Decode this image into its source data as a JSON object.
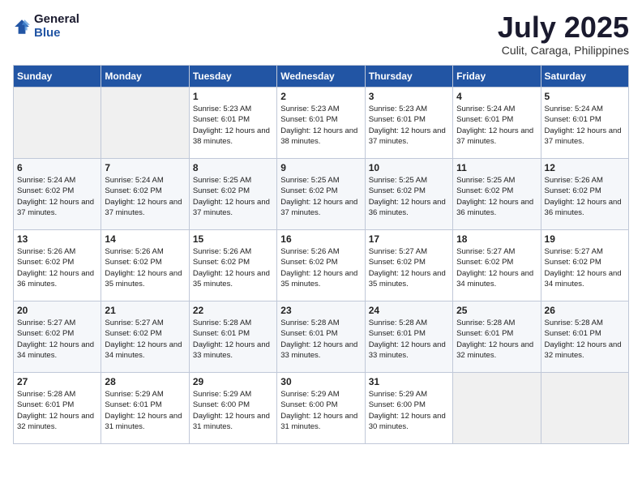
{
  "logo": {
    "general": "General",
    "blue": "Blue"
  },
  "title": "July 2025",
  "location": "Culit, Caraga, Philippines",
  "days_of_week": [
    "Sunday",
    "Monday",
    "Tuesday",
    "Wednesday",
    "Thursday",
    "Friday",
    "Saturday"
  ],
  "weeks": [
    [
      {
        "day": "",
        "sunrise": "",
        "sunset": "",
        "daylight": ""
      },
      {
        "day": "",
        "sunrise": "",
        "sunset": "",
        "daylight": ""
      },
      {
        "day": "1",
        "sunrise": "5:23 AM",
        "sunset": "6:01 PM",
        "daylight": "12 hours and 38 minutes."
      },
      {
        "day": "2",
        "sunrise": "5:23 AM",
        "sunset": "6:01 PM",
        "daylight": "12 hours and 38 minutes."
      },
      {
        "day": "3",
        "sunrise": "5:23 AM",
        "sunset": "6:01 PM",
        "daylight": "12 hours and 37 minutes."
      },
      {
        "day": "4",
        "sunrise": "5:24 AM",
        "sunset": "6:01 PM",
        "daylight": "12 hours and 37 minutes."
      },
      {
        "day": "5",
        "sunrise": "5:24 AM",
        "sunset": "6:01 PM",
        "daylight": "12 hours and 37 minutes."
      }
    ],
    [
      {
        "day": "6",
        "sunrise": "5:24 AM",
        "sunset": "6:02 PM",
        "daylight": "12 hours and 37 minutes."
      },
      {
        "day": "7",
        "sunrise": "5:24 AM",
        "sunset": "6:02 PM",
        "daylight": "12 hours and 37 minutes."
      },
      {
        "day": "8",
        "sunrise": "5:25 AM",
        "sunset": "6:02 PM",
        "daylight": "12 hours and 37 minutes."
      },
      {
        "day": "9",
        "sunrise": "5:25 AM",
        "sunset": "6:02 PM",
        "daylight": "12 hours and 37 minutes."
      },
      {
        "day": "10",
        "sunrise": "5:25 AM",
        "sunset": "6:02 PM",
        "daylight": "12 hours and 36 minutes."
      },
      {
        "day": "11",
        "sunrise": "5:25 AM",
        "sunset": "6:02 PM",
        "daylight": "12 hours and 36 minutes."
      },
      {
        "day": "12",
        "sunrise": "5:26 AM",
        "sunset": "6:02 PM",
        "daylight": "12 hours and 36 minutes."
      }
    ],
    [
      {
        "day": "13",
        "sunrise": "5:26 AM",
        "sunset": "6:02 PM",
        "daylight": "12 hours and 36 minutes."
      },
      {
        "day": "14",
        "sunrise": "5:26 AM",
        "sunset": "6:02 PM",
        "daylight": "12 hours and 35 minutes."
      },
      {
        "day": "15",
        "sunrise": "5:26 AM",
        "sunset": "6:02 PM",
        "daylight": "12 hours and 35 minutes."
      },
      {
        "day": "16",
        "sunrise": "5:26 AM",
        "sunset": "6:02 PM",
        "daylight": "12 hours and 35 minutes."
      },
      {
        "day": "17",
        "sunrise": "5:27 AM",
        "sunset": "6:02 PM",
        "daylight": "12 hours and 35 minutes."
      },
      {
        "day": "18",
        "sunrise": "5:27 AM",
        "sunset": "6:02 PM",
        "daylight": "12 hours and 34 minutes."
      },
      {
        "day": "19",
        "sunrise": "5:27 AM",
        "sunset": "6:02 PM",
        "daylight": "12 hours and 34 minutes."
      }
    ],
    [
      {
        "day": "20",
        "sunrise": "5:27 AM",
        "sunset": "6:02 PM",
        "daylight": "12 hours and 34 minutes."
      },
      {
        "day": "21",
        "sunrise": "5:27 AM",
        "sunset": "6:02 PM",
        "daylight": "12 hours and 34 minutes."
      },
      {
        "day": "22",
        "sunrise": "5:28 AM",
        "sunset": "6:01 PM",
        "daylight": "12 hours and 33 minutes."
      },
      {
        "day": "23",
        "sunrise": "5:28 AM",
        "sunset": "6:01 PM",
        "daylight": "12 hours and 33 minutes."
      },
      {
        "day": "24",
        "sunrise": "5:28 AM",
        "sunset": "6:01 PM",
        "daylight": "12 hours and 33 minutes."
      },
      {
        "day": "25",
        "sunrise": "5:28 AM",
        "sunset": "6:01 PM",
        "daylight": "12 hours and 32 minutes."
      },
      {
        "day": "26",
        "sunrise": "5:28 AM",
        "sunset": "6:01 PM",
        "daylight": "12 hours and 32 minutes."
      }
    ],
    [
      {
        "day": "27",
        "sunrise": "5:28 AM",
        "sunset": "6:01 PM",
        "daylight": "12 hours and 32 minutes."
      },
      {
        "day": "28",
        "sunrise": "5:29 AM",
        "sunset": "6:01 PM",
        "daylight": "12 hours and 31 minutes."
      },
      {
        "day": "29",
        "sunrise": "5:29 AM",
        "sunset": "6:00 PM",
        "daylight": "12 hours and 31 minutes."
      },
      {
        "day": "30",
        "sunrise": "5:29 AM",
        "sunset": "6:00 PM",
        "daylight": "12 hours and 31 minutes."
      },
      {
        "day": "31",
        "sunrise": "5:29 AM",
        "sunset": "6:00 PM",
        "daylight": "12 hours and 30 minutes."
      },
      {
        "day": "",
        "sunrise": "",
        "sunset": "",
        "daylight": ""
      },
      {
        "day": "",
        "sunrise": "",
        "sunset": "",
        "daylight": ""
      }
    ]
  ]
}
